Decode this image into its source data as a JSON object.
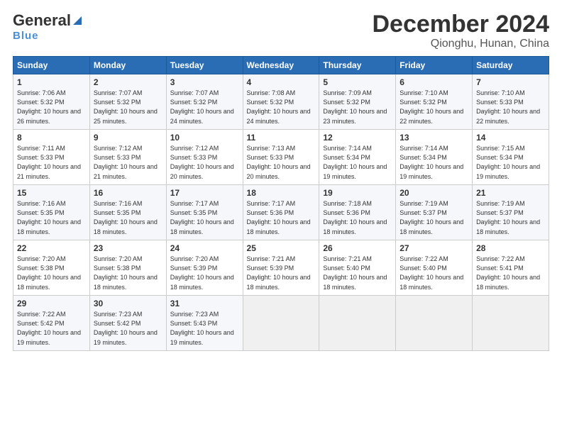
{
  "logo": {
    "name_part1": "General",
    "name_part2": "Blue"
  },
  "title": "December 2024",
  "subtitle": "Qionghu, Hunan, China",
  "weekdays": [
    "Sunday",
    "Monday",
    "Tuesday",
    "Wednesday",
    "Thursday",
    "Friday",
    "Saturday"
  ],
  "weeks": [
    [
      {
        "day": "1",
        "sunrise": "7:06 AM",
        "sunset": "5:32 PM",
        "daylight": "10 hours and 26 minutes."
      },
      {
        "day": "2",
        "sunrise": "7:07 AM",
        "sunset": "5:32 PM",
        "daylight": "10 hours and 25 minutes."
      },
      {
        "day": "3",
        "sunrise": "7:07 AM",
        "sunset": "5:32 PM",
        "daylight": "10 hours and 24 minutes."
      },
      {
        "day": "4",
        "sunrise": "7:08 AM",
        "sunset": "5:32 PM",
        "daylight": "10 hours and 24 minutes."
      },
      {
        "day": "5",
        "sunrise": "7:09 AM",
        "sunset": "5:32 PM",
        "daylight": "10 hours and 23 minutes."
      },
      {
        "day": "6",
        "sunrise": "7:10 AM",
        "sunset": "5:32 PM",
        "daylight": "10 hours and 22 minutes."
      },
      {
        "day": "7",
        "sunrise": "7:10 AM",
        "sunset": "5:33 PM",
        "daylight": "10 hours and 22 minutes."
      }
    ],
    [
      {
        "day": "8",
        "sunrise": "7:11 AM",
        "sunset": "5:33 PM",
        "daylight": "10 hours and 21 minutes."
      },
      {
        "day": "9",
        "sunrise": "7:12 AM",
        "sunset": "5:33 PM",
        "daylight": "10 hours and 21 minutes."
      },
      {
        "day": "10",
        "sunrise": "7:12 AM",
        "sunset": "5:33 PM",
        "daylight": "10 hours and 20 minutes."
      },
      {
        "day": "11",
        "sunrise": "7:13 AM",
        "sunset": "5:33 PM",
        "daylight": "10 hours and 20 minutes."
      },
      {
        "day": "12",
        "sunrise": "7:14 AM",
        "sunset": "5:34 PM",
        "daylight": "10 hours and 19 minutes."
      },
      {
        "day": "13",
        "sunrise": "7:14 AM",
        "sunset": "5:34 PM",
        "daylight": "10 hours and 19 minutes."
      },
      {
        "day": "14",
        "sunrise": "7:15 AM",
        "sunset": "5:34 PM",
        "daylight": "10 hours and 19 minutes."
      }
    ],
    [
      {
        "day": "15",
        "sunrise": "7:16 AM",
        "sunset": "5:35 PM",
        "daylight": "10 hours and 18 minutes."
      },
      {
        "day": "16",
        "sunrise": "7:16 AM",
        "sunset": "5:35 PM",
        "daylight": "10 hours and 18 minutes."
      },
      {
        "day": "17",
        "sunrise": "7:17 AM",
        "sunset": "5:35 PM",
        "daylight": "10 hours and 18 minutes."
      },
      {
        "day": "18",
        "sunrise": "7:17 AM",
        "sunset": "5:36 PM",
        "daylight": "10 hours and 18 minutes."
      },
      {
        "day": "19",
        "sunrise": "7:18 AM",
        "sunset": "5:36 PM",
        "daylight": "10 hours and 18 minutes."
      },
      {
        "day": "20",
        "sunrise": "7:19 AM",
        "sunset": "5:37 PM",
        "daylight": "10 hours and 18 minutes."
      },
      {
        "day": "21",
        "sunrise": "7:19 AM",
        "sunset": "5:37 PM",
        "daylight": "10 hours and 18 minutes."
      }
    ],
    [
      {
        "day": "22",
        "sunrise": "7:20 AM",
        "sunset": "5:38 PM",
        "daylight": "10 hours and 18 minutes."
      },
      {
        "day": "23",
        "sunrise": "7:20 AM",
        "sunset": "5:38 PM",
        "daylight": "10 hours and 18 minutes."
      },
      {
        "day": "24",
        "sunrise": "7:20 AM",
        "sunset": "5:39 PM",
        "daylight": "10 hours and 18 minutes."
      },
      {
        "day": "25",
        "sunrise": "7:21 AM",
        "sunset": "5:39 PM",
        "daylight": "10 hours and 18 minutes."
      },
      {
        "day": "26",
        "sunrise": "7:21 AM",
        "sunset": "5:40 PM",
        "daylight": "10 hours and 18 minutes."
      },
      {
        "day": "27",
        "sunrise": "7:22 AM",
        "sunset": "5:40 PM",
        "daylight": "10 hours and 18 minutes."
      },
      {
        "day": "28",
        "sunrise": "7:22 AM",
        "sunset": "5:41 PM",
        "daylight": "10 hours and 18 minutes."
      }
    ],
    [
      {
        "day": "29",
        "sunrise": "7:22 AM",
        "sunset": "5:42 PM",
        "daylight": "10 hours and 19 minutes."
      },
      {
        "day": "30",
        "sunrise": "7:23 AM",
        "sunset": "5:42 PM",
        "daylight": "10 hours and 19 minutes."
      },
      {
        "day": "31",
        "sunrise": "7:23 AM",
        "sunset": "5:43 PM",
        "daylight": "10 hours and 19 minutes."
      },
      null,
      null,
      null,
      null
    ]
  ]
}
